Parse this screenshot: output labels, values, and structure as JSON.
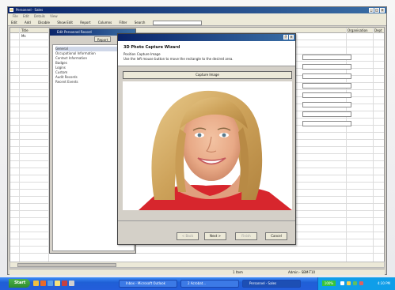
{
  "app": {
    "title": "Personnel - Sales",
    "menu": [
      "File",
      "Edit",
      "Details",
      "View"
    ],
    "toolbar": [
      "Edit",
      "Add",
      "Disable",
      "Show Edit",
      "Report",
      "Columns",
      "Filter",
      "Search"
    ],
    "window_buttons": [
      "_",
      "□",
      "×"
    ]
  },
  "grid": {
    "columns": [
      "Title",
      "Organisation",
      "Dept"
    ],
    "first_row": "Ms"
  },
  "personnel_window": {
    "title": "Edit Personnel Record",
    "tabs": [
      "Report"
    ],
    "nav_items": [
      "General",
      "Occupational Information",
      "Contact Information",
      "Badges",
      "Logins",
      "Custom",
      "Audit Records",
      "Recent Events"
    ]
  },
  "wizard": {
    "heading": "3D Photo Capture Wizard",
    "subheading": "Position Capture Image",
    "description": "Use the left mouse button to move the rectangle to the desired area.",
    "capture_button": "Capture Image",
    "buttons": {
      "back": "< Back",
      "next": "Next >",
      "finish": "Finish",
      "cancel": "Cancel"
    },
    "window_buttons": [
      "?",
      "×"
    ]
  },
  "status": {
    "left": "1 Item",
    "mid": "Admin - SBM-T10"
  },
  "taskbar": {
    "start": "Start",
    "tasks": [
      "Inbox - Microsoft Outlook",
      "2 Acrobat...",
      "Personnel - Sales"
    ],
    "zoom": "100%",
    "clock": "4:30 PM"
  },
  "colors": {
    "title_bar": "#0a246a",
    "taskbar": "#245edb",
    "start_button": "#2e8c2d"
  }
}
